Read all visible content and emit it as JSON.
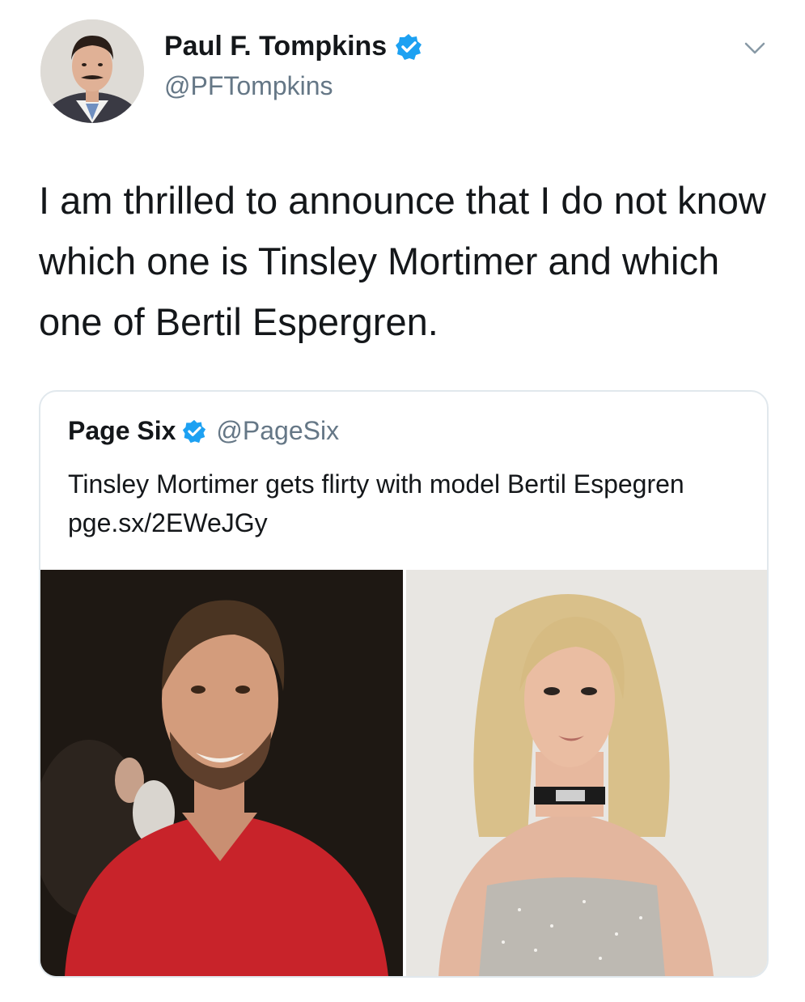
{
  "tweet": {
    "author_name": "Paul F. Tompkins",
    "author_handle": "@PFTompkins",
    "text": "I am thrilled to announce that I do not know which one is Tinsley Mortimer and which one of Bertil Espergren."
  },
  "quoted_tweet": {
    "author_name": "Page Six",
    "author_handle": "@PageSix",
    "text": "Tinsley Mortimer gets flirty with model Bertil Espegren pge.sx/2EWeJGy"
  },
  "icons": {
    "verified": "verified-badge-icon",
    "menu": "chevron-down-icon"
  },
  "colors": {
    "verified": "#1da1f2",
    "handle": "#657786",
    "border": "#e1e8ed"
  }
}
